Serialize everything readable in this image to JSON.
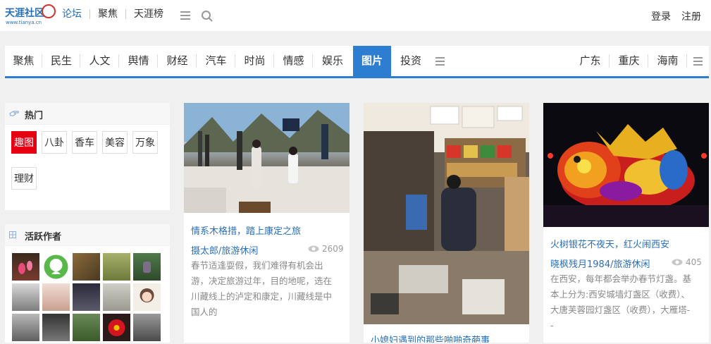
{
  "logo": {
    "name": "天涯社区",
    "url_text": "www.tianya.cn"
  },
  "top_nav": [
    "论坛",
    "聚焦",
    "天涯榜"
  ],
  "auth": {
    "login": "登录",
    "register": "注册"
  },
  "channels_left": [
    "聚焦",
    "民生",
    "人文",
    "舆情",
    "财经",
    "汽车",
    "时尚",
    "情感",
    "娱乐",
    "图片",
    "投资"
  ],
  "channels_right": [
    "广东",
    "重庆",
    "海南"
  ],
  "active_channel": "图片",
  "hot": {
    "title": "热门",
    "tags": [
      "趣图",
      "八卦",
      "香车",
      "美容",
      "万象",
      "理财"
    ],
    "active_tag": "趣图"
  },
  "authors": {
    "title": "活跃作者"
  },
  "cards": [
    {
      "title": "情系木格措，踏上康定之旅",
      "author": "摄太郎/旅游休闲",
      "views": "2609",
      "desc": [
        "春节适逢耍假，我们难得有机会出",
        "游，决定旅游过年，目的地呢，选在",
        "川藏线上的泸定和康定，川藏线是中",
        "国人的"
      ]
    },
    {
      "title": "小媳妇遇到的那些啪啪奇葩事"
    },
    {
      "title": "火树银花不夜天，红火闹西安",
      "author": "晓枫残月1984/旅游休闲",
      "views": "405",
      "desc": [
        "在西安，每年都会举办春节灯盏。基",
        "本上分为:西安城墙灯盏区（收费）、",
        "大唐芙蓉园灯盏区（收费），大雁塔-",
        "-"
      ]
    }
  ],
  "colors": {
    "brand_blue": "#2d7ed1",
    "link_blue": "#2a6fb5",
    "tag_red": "#e60012"
  }
}
